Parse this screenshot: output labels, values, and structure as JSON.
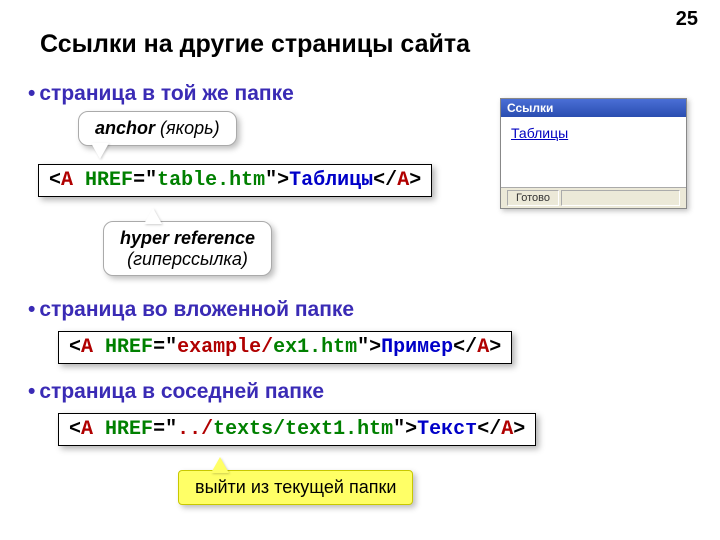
{
  "slide_number": "25",
  "title": "Ссылки на другие страницы сайта",
  "bullets": {
    "b1": "страница в той же папке",
    "b2": "страница во вложенной папке",
    "b3": "страница в соседней папке"
  },
  "callouts": {
    "anchor_b": "anchor",
    "anchor_i": " (якорь)",
    "hyper_b": "hyper reference",
    "hyper_i": "(гиперссылка)",
    "exit": "выйти из текущей папки"
  },
  "code1": {
    "lt": "<",
    "a": "A",
    "sp": " ",
    "attr": "HREF",
    "eq": "=",
    "q": "\"",
    "val": "table.htm",
    "gt": ">",
    "text": "Таблицы",
    "close_lt": "</",
    "close_gt": ">"
  },
  "code2": {
    "lt": "<",
    "a": "A",
    "sp": " ",
    "attr": "HREF",
    "eq": "=",
    "q": "\"",
    "val_red": "example/",
    "val_rest": "ex1.htm",
    "gt": ">",
    "text": "Пример",
    "close_lt": "</",
    "close_gt": ">"
  },
  "code3": {
    "lt": "<",
    "a": "A",
    "sp": " ",
    "attr": "HREF",
    "eq": "=",
    "q": "\"",
    "val_red": "../",
    "val_rest": "texts/text1.htm",
    "gt": ">",
    "text": "Текст",
    "close_lt": "</",
    "close_gt": ">"
  },
  "browser": {
    "title": "Ссылки",
    "link": "Таблицы",
    "status": "Готово"
  }
}
